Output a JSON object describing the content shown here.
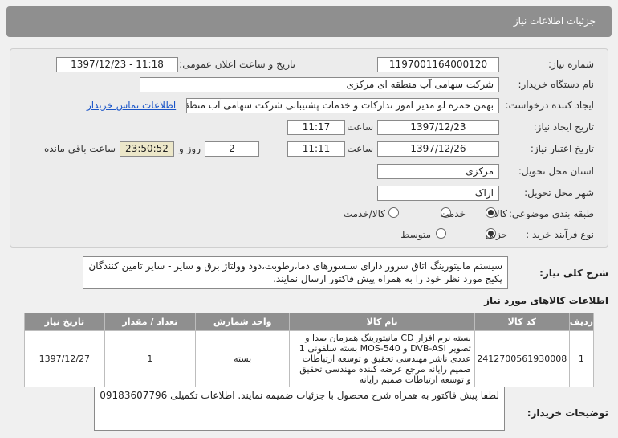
{
  "header": {
    "title": "جزئیات اطلاعات نیاز"
  },
  "form": {
    "need_number_label": "شماره نیاز:",
    "need_number": "1197001164000120",
    "announce_label": "تاریخ و ساعت اعلان عمومی:",
    "announce_value": "1397/12/23 - 11:18",
    "buyer_label": "نام دستگاه خریدار:",
    "buyer_value": "شرکت سهامی آب منطقه ای مرکزی",
    "creator_label": "ایجاد کننده درخواست:",
    "creator_value": "بهمن حمزه لو مدیر امور تدارکات و خدمات پشتیبانی شرکت سهامی آب منطقه",
    "contact_link": "اطلاعات تماس خریدار",
    "created_date_label": "تاریخ ایجاد نیاز:",
    "created_date": "1397/12/23",
    "time_label": "ساعت",
    "created_time": "11:17",
    "validity_label": "تاریخ اعتبار نیاز:",
    "validity_date": "1397/12/26",
    "validity_time": "11:11",
    "days_value": "2",
    "days_label": "روز و",
    "remaining_value": "23:50:52",
    "remaining_label": "ساعت باقی مانده",
    "province_label": "استان محل تحویل:",
    "province_value": "مرکزی",
    "city_label": "شهر محل تحویل:",
    "city_value": "اراک",
    "category_label": "طبقه بندی موضوعی:",
    "category_options": [
      "کالا",
      "خدمت",
      "کالا/خدمت"
    ],
    "process_label": "نوع فرآیند خرید :",
    "process_options": [
      "جزیی",
      "متوسط"
    ]
  },
  "description": {
    "label": "شرح کلی نیاز:",
    "text": "سیستم مانیتورینگ اتاق سرور دارای سنسورهای دما،رطوبت،دود وولتاژ برق و سایر - سایر تامین کنندگان پکیج مورد نظر خود را به همراه پیش فاکتور ارسال نمایند."
  },
  "items": {
    "title": "اطلاعات کالاهای مورد نیاز",
    "columns": [
      "ردیف",
      "کد کالا",
      "نام کالا",
      "واحد شمارش",
      "تعداد / مقدار",
      "تاریخ نیاز"
    ],
    "rows": [
      {
        "row": "1",
        "code": "2412700561930008",
        "name": "بسته نرم افزار CD مانیتورینگ همزمان صدا و تصویر DVB-ASI و MOS-540 بسته سلفونی 1 عددی ناشر مهندسی تحقیق و توسعه ارتباطات صمیم رایانه مرجع عرضه کننده مهندسی تحقیق و توسعه ارتباطات صمیم رایانه",
        "unit": "بسته",
        "qty": "1",
        "date": "1397/12/27"
      }
    ]
  },
  "notes": {
    "label": "توضیحات خریدار:",
    "text": "لطفا پیش فاکتور به همراه شرح محصول با جزئیات ضمیمه نمایند. اطلاعات تکمیلی 09183607796"
  }
}
